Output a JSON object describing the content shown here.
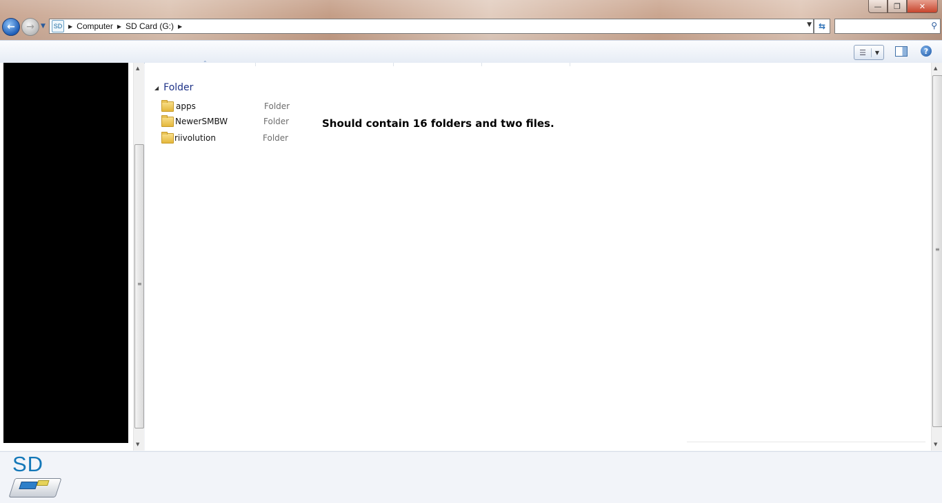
{
  "window": {
    "minimize_glyph": "—",
    "maximize_glyph": "❐",
    "close_glyph": "✕"
  },
  "address": {
    "drive_icon_text": "SD",
    "breadcrumb": [
      "Computer",
      "SD Card (G:)"
    ],
    "search_placeholder": ""
  },
  "icons": {
    "back": "back-arrow-icon",
    "forward": "forward-arrow-icon",
    "refresh": "refresh-icon",
    "search": "search-icon",
    "views": "details-view-icon",
    "preview": "preview-pane-icon",
    "help": "help-icon",
    "folder": "folder-icon",
    "drive": "sd-card-drive-icon"
  },
  "content": {
    "group_label": "Folder",
    "items": [
      {
        "name": "apps",
        "type": "Folder"
      },
      {
        "name": "NewerSMBW",
        "type": "Folder"
      },
      {
        "name": "riivolution",
        "type": "Folder"
      }
    ],
    "annotation": "Should contain 16 folders and two files."
  },
  "details_pane": {
    "drive_label": "SD"
  },
  "colors": {
    "group_label": "#1e3287",
    "drive_label": "#1377b8",
    "back_button": "#1f5fb8"
  }
}
